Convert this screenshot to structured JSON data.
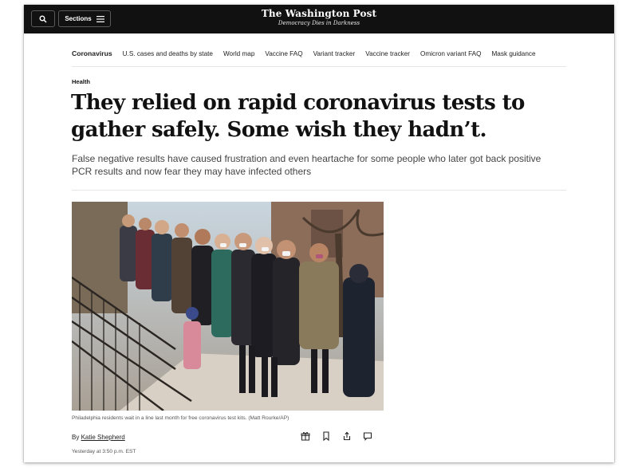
{
  "colors": {
    "masthead_bg": "#111111",
    "text_primary": "#111111",
    "text_secondary": "#444444"
  },
  "masthead": {
    "search_icon": "search-icon",
    "sections_label": "Sections",
    "brand": "The Washington Post",
    "tagline": "Democracy Dies in Darkness"
  },
  "subnav": {
    "items": [
      {
        "label": "Coronavirus",
        "active": true
      },
      {
        "label": "U.S. cases and deaths by state"
      },
      {
        "label": "World map"
      },
      {
        "label": "Vaccine FAQ"
      },
      {
        "label": "Variant tracker"
      },
      {
        "label": "Vaccine tracker"
      },
      {
        "label": "Omicron variant FAQ"
      },
      {
        "label": "Mask guidance"
      }
    ]
  },
  "article": {
    "kicker": "Health",
    "headline": "They relied on rapid coronavirus tests to gather safely. Some wish they hadn’t.",
    "dek": "False negative results have caused frustration and even heartache for some people who later got back positive PCR results and now fear they may have infected others",
    "caption": "Philadelphia residents wait in a line last month for free coronavirus test kits. (Matt Rourke/AP)",
    "byline_prefix": "By",
    "author": "Katie Shepherd",
    "timestamp": "Yesterday at 3:50 p.m. EST",
    "share_icons": [
      "gift-icon",
      "bookmark-icon",
      "share-icon",
      "comment-icon"
    ]
  }
}
